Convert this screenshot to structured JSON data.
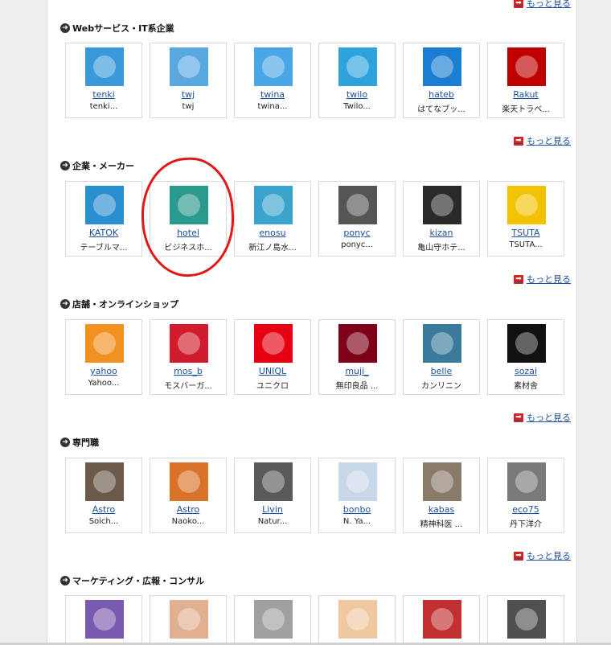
{
  "more_label": "もっと見る",
  "sections": [
    {
      "title": "Webサービス・IT系企業",
      "items": [
        {
          "id": "tenki",
          "name": "tenki...",
          "icon": "tenki-logo-icon",
          "color": "#3a9ad9"
        },
        {
          "id": "twj",
          "name": "twj",
          "icon": "blue-bird-hat-icon",
          "color": "#5aa8e0"
        },
        {
          "id": "twina",
          "name": "twina...",
          "icon": "blue-bird-icon",
          "color": "#4aa6e6"
        },
        {
          "id": "twilo",
          "name": "Twilo...",
          "icon": "twilog-logo-icon",
          "color": "#2fa2dc"
        },
        {
          "id": "hateb",
          "name": "はてなブッ...",
          "icon": "hatena-b-icon",
          "color": "#1a7dd1"
        },
        {
          "id": "Rakut",
          "name": "楽天トラベ...",
          "icon": "rakuten-travel-icon",
          "color": "#bf0000"
        }
      ]
    },
    {
      "title": "企業・メーカー",
      "items": [
        {
          "id": "KATOK",
          "name": "テーブルマ...",
          "icon": "katokichi-logo-icon",
          "color": "#2a8fd0"
        },
        {
          "id": "hotel",
          "name": "ビジネスホ...",
          "icon": "hotel-b-logo-icon",
          "color": "#2a9a8e"
        },
        {
          "id": "enosu",
          "name": "新江ノ島水...",
          "icon": "jellyfish-icon",
          "color": "#3aa4cc"
        },
        {
          "id": "ponyc",
          "name": "ponyc...",
          "icon": "pony-canyon-logo-icon",
          "color": "#555555"
        },
        {
          "id": "kizan",
          "name": "亀山守ホテ...",
          "icon": "mascot-hat-icon",
          "color": "#2a2a2a"
        },
        {
          "id": "TSUTA",
          "name": "TSUTA...",
          "icon": "tsutaya-logo-icon",
          "color": "#f2c200"
        }
      ]
    },
    {
      "title": "店舗・オンラインショップ",
      "items": [
        {
          "id": "yahoo",
          "name": "Yahoo...",
          "icon": "shopping-cart-icon",
          "color": "#f29020"
        },
        {
          "id": "mos_b",
          "name": "モスバーガ...",
          "icon": "mos-burger-logo-icon",
          "color": "#d01c2c"
        },
        {
          "id": "UNIQL",
          "name": "ユニクロ",
          "icon": "uniqlo-logo-icon",
          "color": "#e60012"
        },
        {
          "id": "muji_",
          "name": "無印良品 ...",
          "icon": "muji-logo-icon",
          "color": "#7f0019"
        },
        {
          "id": "belle",
          "name": "カンリニン",
          "icon": "fish-photo-icon",
          "color": "#3a7a9a"
        },
        {
          "id": "sozai",
          "name": "素材舎",
          "icon": "wheat-logo-icon",
          "color": "#111111"
        }
      ]
    },
    {
      "title": "専門職",
      "items": [
        {
          "id": "Astro",
          "name": "Soich...",
          "icon": "astronaut-photo-icon",
          "color": "#6b5a4a"
        },
        {
          "id": "Astro",
          "name": "Naoko...",
          "icon": "astronaut-flag-photo-icon",
          "color": "#d9732a"
        },
        {
          "id": "Livin",
          "name": "Natur...",
          "icon": "person-photo-icon",
          "color": "#5a5a5a"
        },
        {
          "id": "bonbo",
          "name": "N. Ya...",
          "icon": "baby-photo-icon",
          "color": "#c9d8e8"
        },
        {
          "id": "kabas",
          "name": "精神科医 ...",
          "icon": "man-suit-photo-icon",
          "color": "#8a7a6a"
        },
        {
          "id": "eco75",
          "name": "丹下洋介",
          "icon": "man-photo-icon",
          "color": "#7a7a7a"
        }
      ]
    },
    {
      "title": "マーケティング・広報・コンサル",
      "items": [
        {
          "id": "",
          "name": "",
          "icon": "star-character-icon",
          "color": "#7a5ab0"
        },
        {
          "id": "",
          "name": "",
          "icon": "cartoon-man-icon",
          "color": "#e0b090"
        },
        {
          "id": "",
          "name": "",
          "icon": "person-photo-icon",
          "color": "#a0a0a0"
        },
        {
          "id": "",
          "name": "",
          "icon": "cartoon-face-icon",
          "color": "#f0c8a0"
        },
        {
          "id": "",
          "name": "",
          "icon": "collage-photo-icon",
          "color": "#c03030"
        },
        {
          "id": "",
          "name": "",
          "icon": "flower-photo-icon",
          "color": "#505050"
        }
      ]
    }
  ]
}
